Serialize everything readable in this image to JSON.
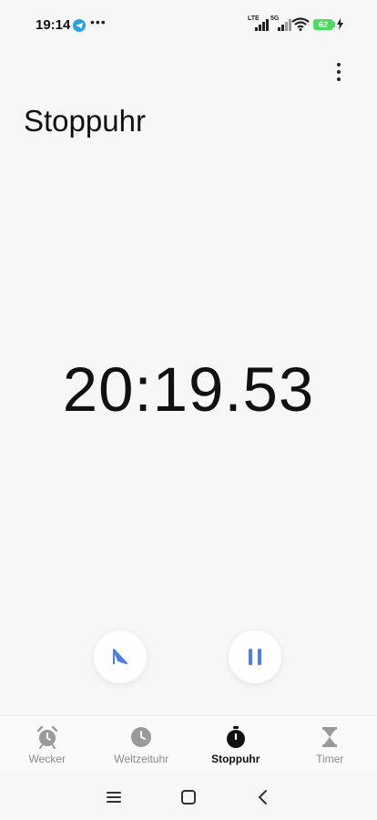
{
  "status": {
    "time": "19:14",
    "network_1": "LTE",
    "network_2": "5G",
    "battery": "62"
  },
  "page": {
    "title": "Stoppuhr"
  },
  "stopwatch": {
    "elapsed": "20:19.53"
  },
  "tabs": [
    {
      "label": "Wecker",
      "icon": "alarm-clock-icon",
      "active": false
    },
    {
      "label": "Weltzeituhr",
      "icon": "clock-icon",
      "active": false
    },
    {
      "label": "Stoppuhr",
      "icon": "stopwatch-icon",
      "active": true
    },
    {
      "label": "Timer",
      "icon": "hourglass-icon",
      "active": false
    }
  ],
  "colors": {
    "accent": "#4a7fe8",
    "background": "#f7f7f7",
    "battery": "#4cd964"
  }
}
